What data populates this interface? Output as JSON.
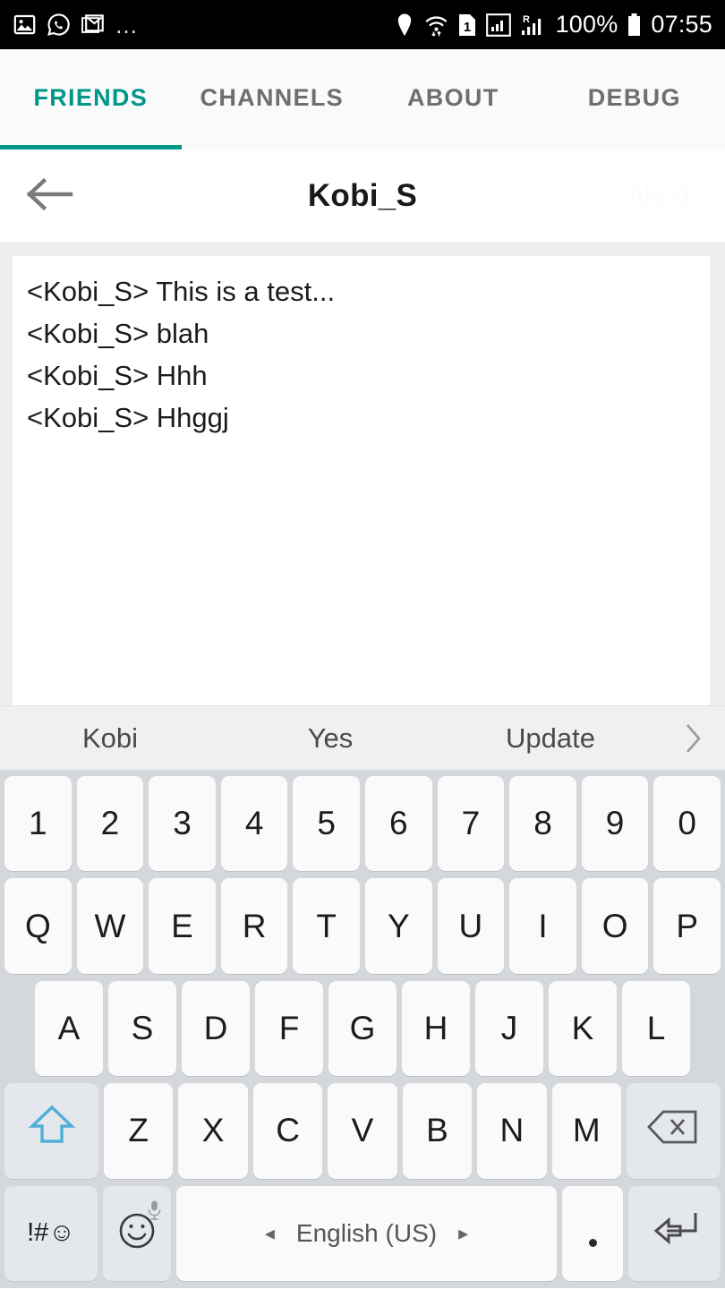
{
  "status_bar": {
    "time": "07:55",
    "battery_percent": "100%",
    "left_icons": [
      "photos-icon",
      "whatsapp-icon",
      "gmail-icon"
    ],
    "overflow": "…",
    "right_icons": [
      "location-icon",
      "wifi-icon",
      "sim1-icon",
      "signal-icon",
      "roaming-signal-icon",
      "battery-icon"
    ],
    "sim_label": "1",
    "roaming_label": "R"
  },
  "tabs": [
    {
      "label": "FRIENDS",
      "active": true
    },
    {
      "label": "CHANNELS",
      "active": false
    },
    {
      "label": "ABOUT",
      "active": false
    },
    {
      "label": "DEBUG",
      "active": false
    }
  ],
  "title_bar": {
    "back_icon": "arrow-left-icon",
    "title": "Kobi_S",
    "next_label": "Next"
  },
  "conversation": {
    "messages": [
      "<Kobi_S> This is a test...",
      "<Kobi_S> blah",
      "<Kobi_S> Hhh",
      "<Kobi_S> Hhggj"
    ]
  },
  "suggestions": {
    "items": [
      "Kobi",
      "Yes",
      "Update"
    ],
    "expand_icon": "chevron-right-icon"
  },
  "keyboard": {
    "rows": {
      "digits": [
        "1",
        "2",
        "3",
        "4",
        "5",
        "6",
        "7",
        "8",
        "9",
        "0"
      ],
      "qwerty": [
        "Q",
        "W",
        "E",
        "R",
        "T",
        "Y",
        "U",
        "I",
        "O",
        "P"
      ],
      "asdf": [
        "A",
        "S",
        "D",
        "F",
        "G",
        "H",
        "J",
        "K",
        "L"
      ],
      "zxcv": [
        "Z",
        "X",
        "C",
        "V",
        "B",
        "N",
        "M"
      ]
    },
    "shift_icon": "shift-up-arrow-icon",
    "backspace_icon": "backspace-icon",
    "symbols_label": "!#☺",
    "emoji_icon": "emoji-smiley-icon",
    "mic_icon": "microphone-icon",
    "space_label": "English (US)",
    "space_prev_icon": "triangle-left-icon",
    "space_next_icon": "triangle-right-icon",
    "period_label": ".",
    "enter_icon": "enter-return-icon"
  },
  "colors": {
    "accent_teal": "#009688",
    "status_bar_bg": "#000000",
    "keyboard_bg": "#d4d7dc",
    "key_bg": "#fafafa",
    "fn_key_bg": "#e4e7ec",
    "shift_active_blue": "#4FAFD8",
    "panel_bg": "#efefef"
  }
}
